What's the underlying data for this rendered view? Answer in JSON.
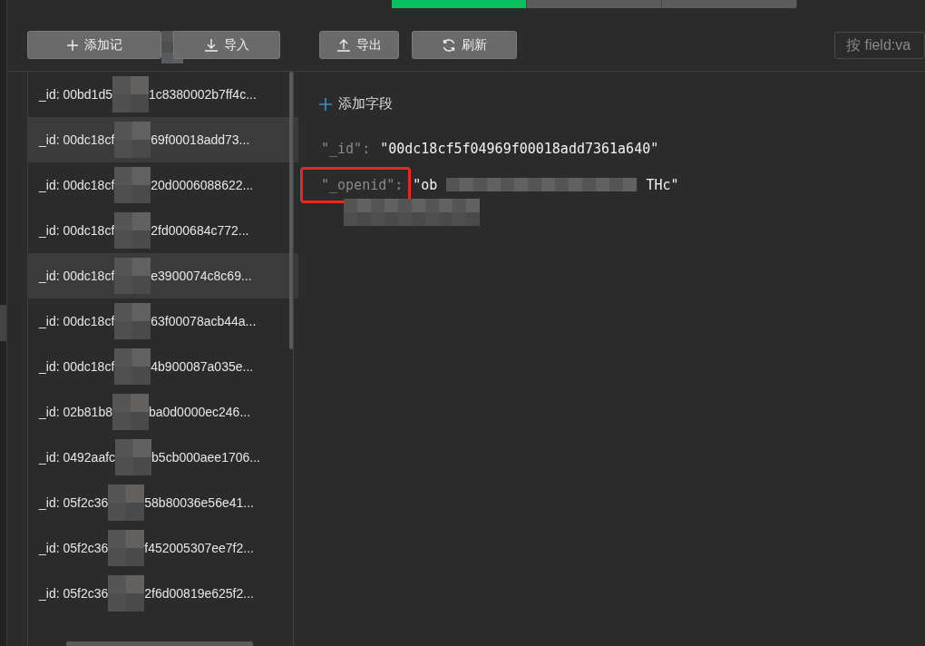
{
  "top_tabs": [
    {
      "selected": true
    },
    {
      "selected": false
    },
    {
      "selected": false
    }
  ],
  "toolbar": {
    "buttons": [
      {
        "kind": "add",
        "label": "添加记",
        "redacted": true
      },
      {
        "kind": "import",
        "label": "导入",
        "redacted": false
      },
      {
        "kind": "export",
        "label": "导出",
        "redacted": false
      },
      {
        "kind": "refresh",
        "label": "刷新",
        "redacted": false
      }
    ],
    "search": {
      "placeholder": "按 field:va"
    }
  },
  "records": [
    {
      "prefix": "_id: 00bd1d5",
      "suffix": "1c8380002b7ff4c...",
      "selected": false
    },
    {
      "prefix": "_id: 00dc18cf",
      "suffix": "69f00018add73...",
      "selected": true
    },
    {
      "prefix": "_id: 00dc18cf",
      "suffix": "20d0006088622...",
      "selected": false
    },
    {
      "prefix": "_id: 00dc18cf",
      "suffix": "2fd000684c772...",
      "selected": false
    },
    {
      "prefix": "_id: 00dc18cf",
      "suffix": "e3900074c8c69...",
      "selected": true
    },
    {
      "prefix": "_id: 00dc18cf",
      "suffix": "63f00078acb44a...",
      "selected": false
    },
    {
      "prefix": "_id: 00dc18cf",
      "suffix": "4b900087a035e...",
      "selected": false
    },
    {
      "prefix": "_id: 02b81b8",
      "suffix": "ba0d0000ec246...",
      "selected": false
    },
    {
      "prefix": "_id: 0492aafc",
      "suffix": "b5cb000aee1706...",
      "selected": false
    },
    {
      "prefix": "_id: 05f2c36",
      "suffix": "58b80036e56e41...",
      "selected": false
    },
    {
      "prefix": "_id: 05f2c36",
      "suffix": "f452005307ee7f2...",
      "selected": false
    },
    {
      "prefix": "_id: 05f2c36",
      "suffix": "2f6d00819e625f2...",
      "selected": false
    }
  ],
  "detail": {
    "add_field": "添加字段",
    "fields": [
      {
        "key": "\"_id\":",
        "value_start": "\"00dc18cf5f04969f00018add7361a640\"",
        "highlighted": false
      },
      {
        "key": "\"_openid\":",
        "value_start": "\"ob",
        "value_end": "THc\"",
        "highlighted": true
      }
    ]
  }
}
